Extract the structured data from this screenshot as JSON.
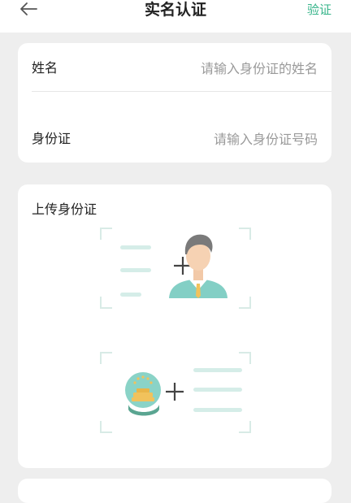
{
  "header": {
    "title": "实名认证",
    "verify_label": "验证",
    "back_icon": "arrow-left-icon"
  },
  "form": {
    "name": {
      "label": "姓名",
      "placeholder": "请输入身份证的姓名"
    },
    "id_number": {
      "label": "身份证",
      "placeholder": "请输入身份证号码"
    }
  },
  "upload": {
    "title": "上传身份证",
    "front_slot_icon": "id-card-front-portrait-icon",
    "back_slot_icon": "id-card-back-emblem-icon"
  },
  "colors": {
    "accent": "#36b48a",
    "background": "#eeeeee",
    "card": "#ffffff"
  }
}
